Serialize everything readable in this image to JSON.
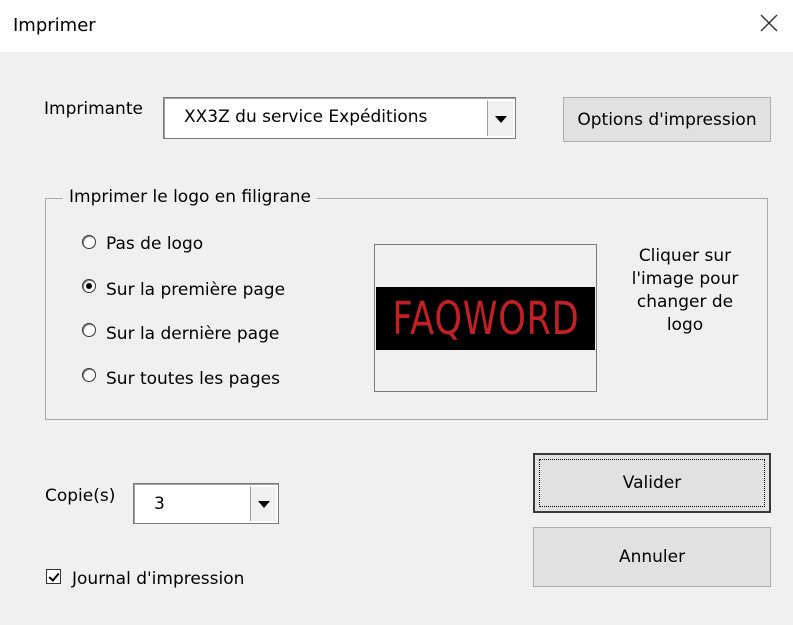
{
  "window": {
    "title": "Imprimer"
  },
  "printer": {
    "label": "Imprimante",
    "value": "XX3Z du service Expéditions",
    "options_button": "Options d'impression"
  },
  "watermark": {
    "group_label": "Imprimer le logo en filigrane",
    "options": [
      {
        "label": "Pas de logo",
        "selected": false
      },
      {
        "label": "Sur la première page",
        "selected": true
      },
      {
        "label": "Sur la dernière page",
        "selected": false
      },
      {
        "label": "Sur toutes les pages",
        "selected": false
      }
    ],
    "logo_text": "FAQWORD",
    "hint": "Cliquer sur l'image pour changer de logo"
  },
  "copies": {
    "label": "Copie(s)",
    "value": "3"
  },
  "buttons": {
    "ok": "Valider",
    "cancel": "Annuler"
  },
  "log": {
    "label": "Journal d'impression",
    "checked": true
  },
  "colors": {
    "logo_red": "#c51f26",
    "logo_background": "#000000"
  }
}
